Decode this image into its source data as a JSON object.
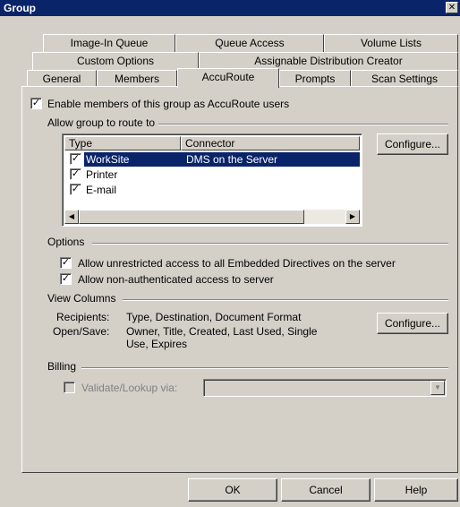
{
  "window": {
    "title": "Group",
    "close_glyph": "✕"
  },
  "tabs": {
    "row1": [
      "Image-In Queue",
      "Queue Access",
      "Volume Lists"
    ],
    "row2": [
      "Custom Options",
      "Assignable Distribution Creator"
    ],
    "row3": [
      "General",
      "Members",
      "AccuRoute",
      "Prompts",
      "Scan Settings"
    ],
    "active": "AccuRoute"
  },
  "enable": {
    "label": "Enable members of this group as AccuRoute users",
    "checked": true
  },
  "route_group": {
    "label": "Allow group to route to",
    "columns": [
      "Type",
      "Connector"
    ],
    "rows": [
      {
        "type": "WorkSite",
        "connector": "DMS on the Server",
        "checked": true,
        "selected": true
      },
      {
        "type": "Printer",
        "connector": "",
        "checked": true,
        "selected": false
      },
      {
        "type": "E-mail",
        "connector": "",
        "checked": true,
        "selected": false
      }
    ],
    "configure_label": "Configure..."
  },
  "options": {
    "label": "Options",
    "items": [
      {
        "label": "Allow unrestricted access to all Embedded Directives on the server",
        "checked": true
      },
      {
        "label": "Allow non-authenticated access to server",
        "checked": true
      }
    ]
  },
  "view_columns": {
    "label": "View Columns",
    "recipients_key": "Recipients:",
    "recipients_value": "Type, Destination, Document Format",
    "opensave_key": "Open/Save:",
    "opensave_value_1": "Owner, Title, Created, Last Used, Single",
    "opensave_value_2": "Use, Expires",
    "configure_label": "Configure..."
  },
  "billing": {
    "label": "Billing",
    "validate_label": "Validate/Lookup via:",
    "validate_checked": false,
    "value": ""
  },
  "footer": {
    "ok": "OK",
    "cancel": "Cancel",
    "help": "Help"
  },
  "icons": {
    "check": "✓",
    "scroll_left": "◀",
    "scroll_right": "▶",
    "dropdown": "▼"
  },
  "colors": {
    "titlebar": "#0a246a",
    "face": "#d4d0c8",
    "selection": "#0a246a"
  }
}
